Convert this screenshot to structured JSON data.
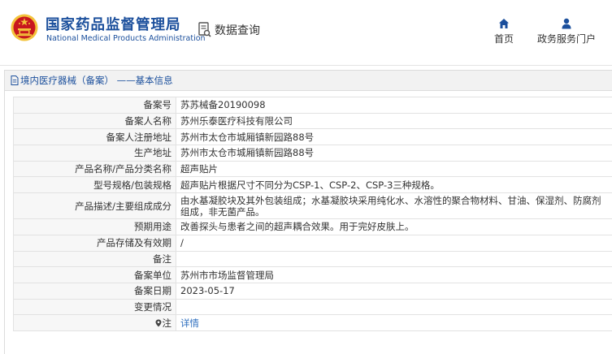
{
  "header": {
    "org_name_cn": "国家药品监督管理局",
    "org_name_en": "National Medical Products Administration",
    "data_query_label": "数据查询",
    "nav": {
      "home_label": "首页",
      "gov_portal_label": "政务服务门户"
    }
  },
  "panel": {
    "title": "境内医疗器械（备案） ——基本信息"
  },
  "record": {
    "rows": [
      {
        "label": "备案号",
        "value": "苏苏械备20190098"
      },
      {
        "label": "备案人名称",
        "value": "苏州乐泰医疗科技有限公司"
      },
      {
        "label": "备案人注册地址",
        "value": "苏州市太仓市城厢镇新园路88号"
      },
      {
        "label": "生产地址",
        "value": "苏州市太仓市城厢镇新园路88号"
      },
      {
        "label": "产品名称/产品分类名称",
        "value": "超声贴片"
      },
      {
        "label": "型号规格/包装规格",
        "value": "超声贴片根据尺寸不同分为CSP-1、CSP-2、CSP-3三种规格。"
      },
      {
        "label": "产品描述/主要组成成分",
        "value": "由水基凝胶块及其外包装组成；水基凝胶块采用纯化水、水溶性的聚合物材料、甘油、保湿剂、防腐剂组成，非无菌产品。"
      },
      {
        "label": "预期用途",
        "value": "改善探头与患者之间的超声耦合效果。用于完好皮肤上。"
      },
      {
        "label": "产品存储及有效期",
        "value": "/"
      },
      {
        "label": "备注",
        "value": ""
      },
      {
        "label": "备案单位",
        "value": "苏州市市场监督管理局"
      },
      {
        "label": "备案日期",
        "value": "2023-05-17"
      },
      {
        "label": "变更情况",
        "value": ""
      }
    ],
    "note": {
      "label": "注",
      "link": "详情"
    }
  },
  "colors": {
    "brand_blue": "#1b4f9c",
    "emblem_red": "#c8171e",
    "emblem_gold": "#f3c33b",
    "link_blue": "#2f6fbf"
  },
  "icons": {
    "emblem": "national-emblem-icon",
    "data_query": "document-search-icon",
    "home": "home-icon",
    "user": "user-icon",
    "panel": "document-icon",
    "note": "location-pin-icon"
  }
}
